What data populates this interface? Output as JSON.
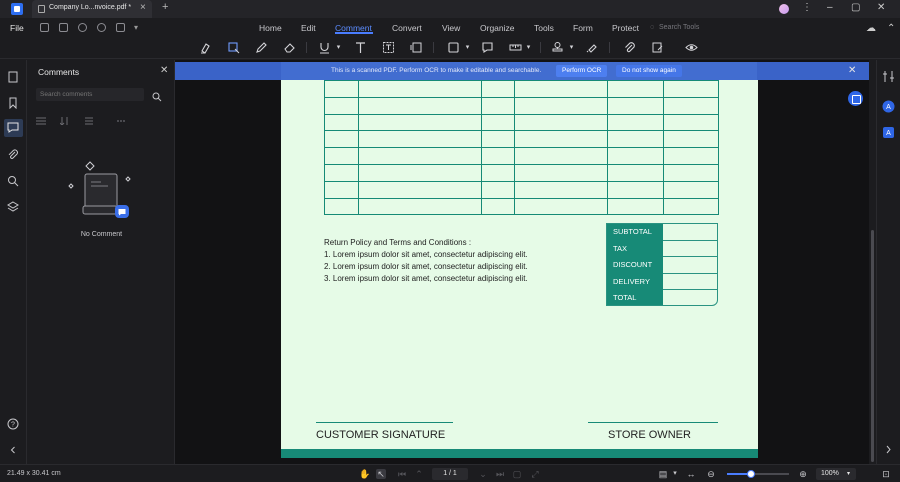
{
  "tab": {
    "title": "Company Lo...nvoice.pdf *"
  },
  "menu": {
    "file": "File",
    "items": [
      "Home",
      "Edit",
      "Comment",
      "Convert",
      "View",
      "Organize",
      "Tools",
      "Form",
      "Protect"
    ],
    "active": "Comment",
    "search_placeholder": "Search Tools"
  },
  "toolbar": {
    "icons": [
      "highlight-icon",
      "area-highlight-icon",
      "pencil-icon",
      "eraser-icon",
      "underline-icon",
      "text-icon",
      "textbox-icon",
      "callout-icon",
      "shape-icon",
      "comment-icon",
      "measure-icon",
      "stamp-icon",
      "signature-icon",
      "attachment-icon",
      "edit-note-icon",
      "eye-icon"
    ]
  },
  "left_rail": {
    "icons": [
      "page-thumbnails-icon",
      "bookmark-icon",
      "comment-icon",
      "attachment-icon",
      "search-icon",
      "layers-icon",
      "help-icon",
      "collapse-icon"
    ]
  },
  "comments_panel": {
    "title": "Comments",
    "search_placeholder": "Search comments",
    "empty_label": "No Comment"
  },
  "ocr_banner": {
    "message": "This is a scanned PDF. Perform OCR to make it editable and searchable.",
    "perform_button": "Perform OCR",
    "dismiss_button": "Do not show again"
  },
  "document": {
    "policy_heading": "Return Policy and Terms and Conditions :",
    "policy_lines": [
      "1. Lorem ipsum dolor sit amet, consectetur adipiscing elit.",
      "2. Lorem ipsum dolor sit amet, consectetur adipiscing elit.",
      "3. Lorem ipsum dolor sit amet, consectetur adipiscing elit."
    ],
    "totals_labels": [
      "SUBTOTAL",
      "TAX",
      "DISCOUNT",
      "DELIVERY",
      "TOTAL"
    ],
    "customer_signature": "CUSTOMER SIGNATURE",
    "store_owner": "STORE OWNER",
    "colors": {
      "page_bg": "#e6fbe7",
      "accent": "#178a77"
    }
  },
  "status": {
    "dimensions": "21.49 x 30.41 cm",
    "page_indicator": "1 / 1",
    "zoom": "100%",
    "zoom_fraction": 0.38
  }
}
